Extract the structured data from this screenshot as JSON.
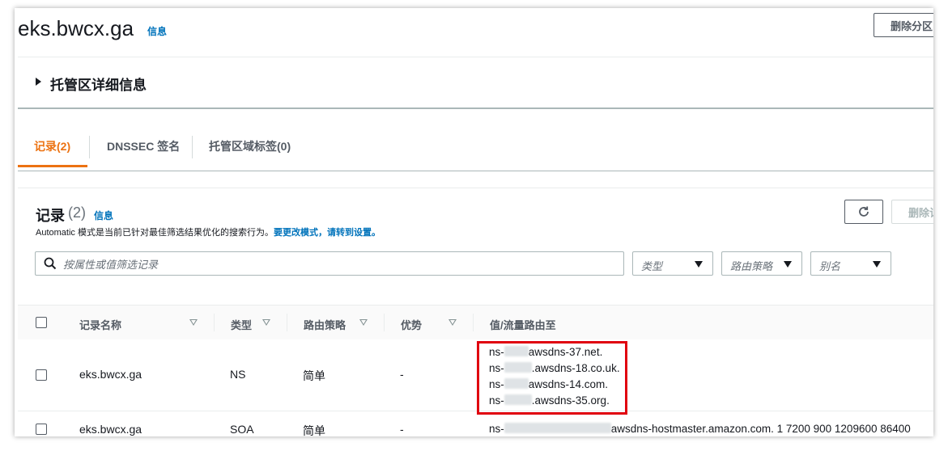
{
  "header": {
    "zone_name": "eks.bwcx.ga",
    "info_label": "信息",
    "delete_zone_button": "删除分区"
  },
  "details_panel": {
    "label": "托管区详细信息"
  },
  "tabs": [
    {
      "label": "记录(2)",
      "active": true
    },
    {
      "label": "DNSSEC 签名",
      "active": false
    },
    {
      "label": "托管区域标签(0)",
      "active": false
    }
  ],
  "records": {
    "title": "记录",
    "count": "(2)",
    "info_label": "信息",
    "description_prefix": "Automatic 模式是当前已针对最佳筛选结果优化的搜索行为。",
    "description_link": "要更改模式，请转到设置。",
    "delete_button": "删除记",
    "search_placeholder": "按属性或值筛选记录",
    "filters": {
      "type": "类型",
      "routing_policy": "路由策略",
      "alias": "别名"
    },
    "columns": {
      "name": "记录名称",
      "type": "类型",
      "routing_policy": "路由策略",
      "differentiator": "优势",
      "value": "值/流量路由至"
    },
    "rows": [
      {
        "name": "eks.bwcx.ga",
        "type": "NS",
        "routing_policy": "简单",
        "differentiator": "-",
        "values": [
          {
            "prefix": "ns-",
            "suffix": "awsdns-37.net."
          },
          {
            "prefix": "ns-",
            "suffix": ".awsdns-18.co.uk."
          },
          {
            "prefix": "ns-",
            "suffix": "awsdns-14.com."
          },
          {
            "prefix": "ns-",
            "suffix": ".awsdns-35.org."
          }
        ]
      },
      {
        "name": "eks.bwcx.ga",
        "type": "SOA",
        "routing_policy": "简单",
        "differentiator": "-",
        "value_prefix": "ns-",
        "value_suffix": "awsdns-hostmaster.amazon.com. 1 7200 900 1209600 86400"
      }
    ]
  },
  "colors": {
    "accent_tab": "#ec7211",
    "link": "#0073bb",
    "highlight_box": "#e0000f"
  }
}
